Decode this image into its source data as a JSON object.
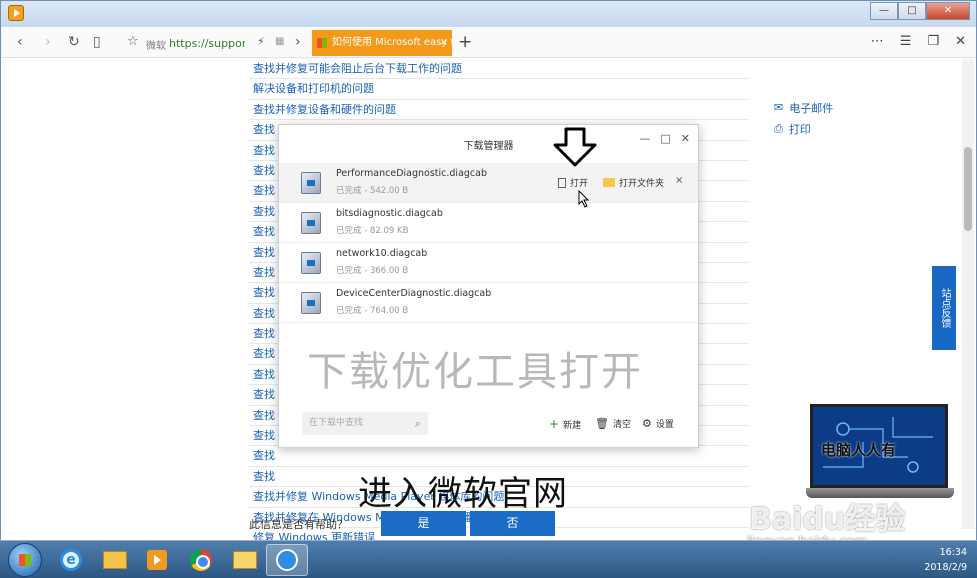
{
  "browser": {
    "fav_label": "微软",
    "address": "https://support.microsoft.com",
    "tab_title": "如何使用 Microsoft easy fix",
    "tab_close": "×",
    "new_tab": "+",
    "window_controls": [
      "—",
      "□",
      "✕"
    ]
  },
  "page": {
    "links": [
      "查找并修复可能会阻止后台下载工作的问题",
      "解决设备和打印机的问题",
      "查找并修复设备和硬件的问题",
      "查找",
      "查找",
      "查找",
      "查找",
      "查找",
      "查找",
      "查找",
      "查找",
      "查找",
      "查找",
      "查找",
      "查找",
      "查找",
      "查找",
      "查找",
      "查找",
      "查找",
      "查找",
      "查找并修复 Windows Media Player 媒体库的问题",
      "查找并修复在 Windows Media Player 中播放 DVD 的问题",
      "修复 Windows 更新错误"
    ],
    "side_email": "电子邮件",
    "side_print": "打印",
    "feedback": "站点反馈",
    "helpful_question": "此信息是否有帮助？",
    "yes": "是",
    "no": "否"
  },
  "download_manager": {
    "title": "下载管理器",
    "items": [
      {
        "name": "PerformanceDiagnostic.diagcab",
        "status": "已完成 - 542.00 B"
      },
      {
        "name": "bitsdiagnostic.diagcab",
        "status": "已完成 - 82.09 KB"
      },
      {
        "name": "network10.diagcab",
        "status": "已完成 - 366.00 B"
      },
      {
        "name": "DeviceCenterDiagnostic.diagcab",
        "status": "已完成 - 764.00 B"
      }
    ],
    "open": "打开",
    "open_folder": "打开文件夹",
    "remove": "×",
    "search_placeholder": "在下载中查找",
    "new": "新建",
    "clear": "清空",
    "settings": "设置"
  },
  "captions": {
    "overlay": "下载优化工具打开",
    "bottom": "进入微软官网",
    "laptop_text": "电脑人人有"
  },
  "watermark": {
    "logo": "Baidu经验",
    "url": "jingyan.baidu.com"
  },
  "taskbar": {
    "time": "16:34",
    "date": "2018/2/9"
  }
}
